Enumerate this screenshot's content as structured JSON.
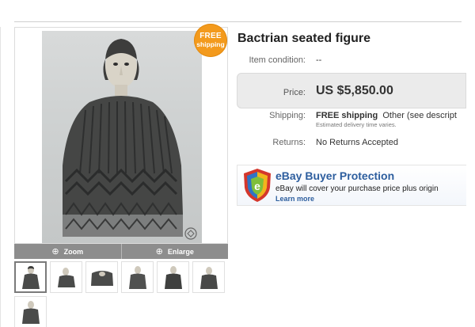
{
  "listing": {
    "title": "Bactrian seated figure",
    "badge": {
      "line1": "FREE",
      "line2": "shipping"
    },
    "photo_name": "bactrian-figure-photo",
    "item_condition": {
      "label": "Item condition:",
      "value": "--"
    },
    "price": {
      "label": "Price:",
      "value": "US $5,850.00"
    },
    "shipping": {
      "label": "Shipping:",
      "value_bold": "FREE shipping",
      "value_rest": "Other (see descript",
      "note": "Estimated delivery time varies."
    },
    "returns": {
      "label": "Returns:",
      "value": "No Returns Accepted"
    }
  },
  "image_controls": {
    "zoom_label": "Zoom",
    "enlarge_label": "Enlarge",
    "zoom_icon": "crosshair-icon",
    "enlarge_icon": "magnifier-plus-icon"
  },
  "thumbnails": [
    {
      "label": "thumbnail-1",
      "active": true
    },
    {
      "label": "thumbnail-2",
      "active": false
    },
    {
      "label": "thumbnail-3",
      "active": false
    },
    {
      "label": "thumbnail-4",
      "active": false
    },
    {
      "label": "thumbnail-5",
      "active": false
    },
    {
      "label": "thumbnail-6",
      "active": false
    },
    {
      "label": "thumbnail-7",
      "active": false
    }
  ],
  "protection": {
    "title": "eBay Buyer Protection",
    "text": "eBay will cover your purchase price plus origin",
    "link": "Learn more",
    "icon": "shield-icon"
  },
  "colors": {
    "badge": "#f39a1d",
    "protection_title": "#2d5e9e",
    "zoom_bar": "#8d8d8d",
    "price_box": "#ebebeb"
  }
}
